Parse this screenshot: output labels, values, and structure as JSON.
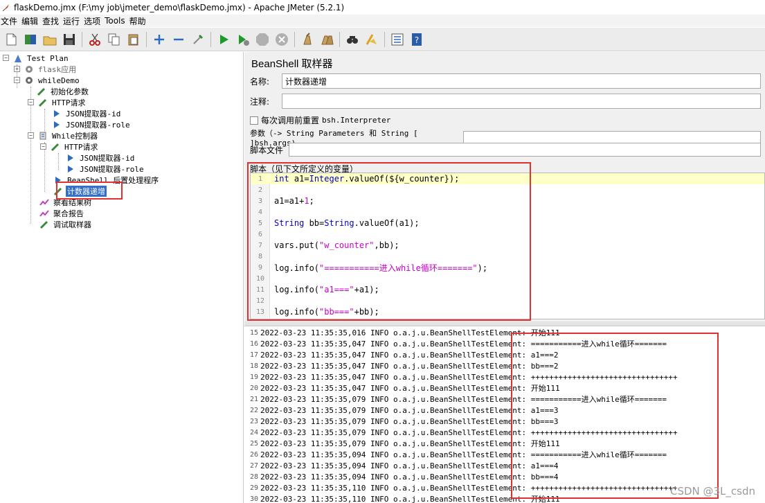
{
  "window": {
    "title": "flaskDemo.jmx (F:\\my job\\jmeter_demo\\flaskDemo.jmx) - Apache JMeter (5.2.1)"
  },
  "menu": [
    "文件",
    "编辑",
    "查找",
    "运行",
    "选项",
    "Tools",
    "帮助"
  ],
  "toolbar": [
    "new-icon",
    "templates-icon",
    "open-icon",
    "save-icon",
    "cut-icon",
    "copy-icon",
    "paste-icon",
    "expand-icon",
    "collapse-icon",
    "toggle-icon",
    "start-icon",
    "start-no-pause-icon",
    "stop-icon",
    "shutdown-icon",
    "clear-icon",
    "clear-all-icon",
    "search-icon",
    "reset-search-icon",
    "function-helper-icon",
    "help-icon"
  ],
  "tree": {
    "root": "Test Plan",
    "flask": "flask应用",
    "while_demo": "whileDemo",
    "init_params": "初始化参数",
    "http1": "HTTP请求",
    "json_id1": "JSON提取器-id",
    "json_role1": "JSON提取器-role",
    "while_ctrl": "While控制器",
    "http2": "HTTP请求",
    "json_id2": "JSON提取器-id",
    "json_role2": "JSON提取器-role",
    "beanshell_post": "BeanShell 后置处理程序",
    "counter_inc": "计数器递增",
    "view_results": "察看结果树",
    "aggregate": "聚合报告",
    "debug": "调试取样器"
  },
  "panel": {
    "title": "BeanShell 取样器",
    "name_label": "名称:",
    "name_value": "计数器递增",
    "comment_label": "注释:",
    "comment_value": "",
    "reset_label": "每次调用前重置",
    "reset_interp": "bsh.Interpreter",
    "params_label": "参数（-> String Parameters 和 String [ ]bsh.args)",
    "script_file_label": "脚本文件",
    "script_group_label": "脚本（见下文所定义的变量）"
  },
  "script_lines": [
    {
      "n": "1",
      "t": "int a1=Integer.valueOf(${w_counter});"
    },
    {
      "n": "2",
      "t": ""
    },
    {
      "n": "3",
      "t": "a1=a1+1;"
    },
    {
      "n": "4",
      "t": ""
    },
    {
      "n": "5",
      "t": "String bb=String.valueOf(a1);"
    },
    {
      "n": "6",
      "t": ""
    },
    {
      "n": "7",
      "t": "vars.put(\"w_counter\",bb);"
    },
    {
      "n": "8",
      "t": ""
    },
    {
      "n": "9",
      "t": "log.info(\"===========进入while循环=======\");"
    },
    {
      "n": "10",
      "t": ""
    },
    {
      "n": "11",
      "t": "log.info(\"a1===\"+a1);"
    },
    {
      "n": "12",
      "t": ""
    },
    {
      "n": "13",
      "t": "log.info(\"bb===\"+bb);"
    }
  ],
  "log_lines": [
    {
      "n": "15",
      "t": "2022-03-23 11:35:35,016 INFO o.a.j.u.BeanShellTestElement: 开始111"
    },
    {
      "n": "16",
      "t": "2022-03-23 11:35:35,047 INFO o.a.j.u.BeanShellTestElement: ===========进入while循环======="
    },
    {
      "n": "17",
      "t": "2022-03-23 11:35:35,047 INFO o.a.j.u.BeanShellTestElement: a1===2"
    },
    {
      "n": "18",
      "t": "2022-03-23 11:35:35,047 INFO o.a.j.u.BeanShellTestElement: bb===2"
    },
    {
      "n": "19",
      "t": "2022-03-23 11:35:35,047 INFO o.a.j.u.BeanShellTestElement: ++++++++++++++++++++++++++++++++"
    },
    {
      "n": "20",
      "t": "2022-03-23 11:35:35,047 INFO o.a.j.u.BeanShellTestElement: 开始111"
    },
    {
      "n": "21",
      "t": "2022-03-23 11:35:35,079 INFO o.a.j.u.BeanShellTestElement: ===========进入while循环======="
    },
    {
      "n": "22",
      "t": "2022-03-23 11:35:35,079 INFO o.a.j.u.BeanShellTestElement: a1===3"
    },
    {
      "n": "23",
      "t": "2022-03-23 11:35:35,079 INFO o.a.j.u.BeanShellTestElement: bb===3"
    },
    {
      "n": "24",
      "t": "2022-03-23 11:35:35,079 INFO o.a.j.u.BeanShellTestElement: ++++++++++++++++++++++++++++++++"
    },
    {
      "n": "25",
      "t": "2022-03-23 11:35:35,079 INFO o.a.j.u.BeanShellTestElement: 开始111"
    },
    {
      "n": "26",
      "t": "2022-03-23 11:35:35,094 INFO o.a.j.u.BeanShellTestElement: ===========进入while循环======="
    },
    {
      "n": "27",
      "t": "2022-03-23 11:35:35,094 INFO o.a.j.u.BeanShellTestElement: a1===4"
    },
    {
      "n": "28",
      "t": "2022-03-23 11:35:35,094 INFO o.a.j.u.BeanShellTestElement: bb===4"
    },
    {
      "n": "29",
      "t": "2022-03-23 11:35:35,110 INFO o.a.j.u.BeanShellTestElement: ++++++++++++++++++++++++++++++++"
    },
    {
      "n": "30",
      "t": "2022-03-23 11:35:35,110 INFO o.a.j.u.BeanShellTestElement: 开始111"
    }
  ],
  "watermark": "CSDN @3L_csdn"
}
